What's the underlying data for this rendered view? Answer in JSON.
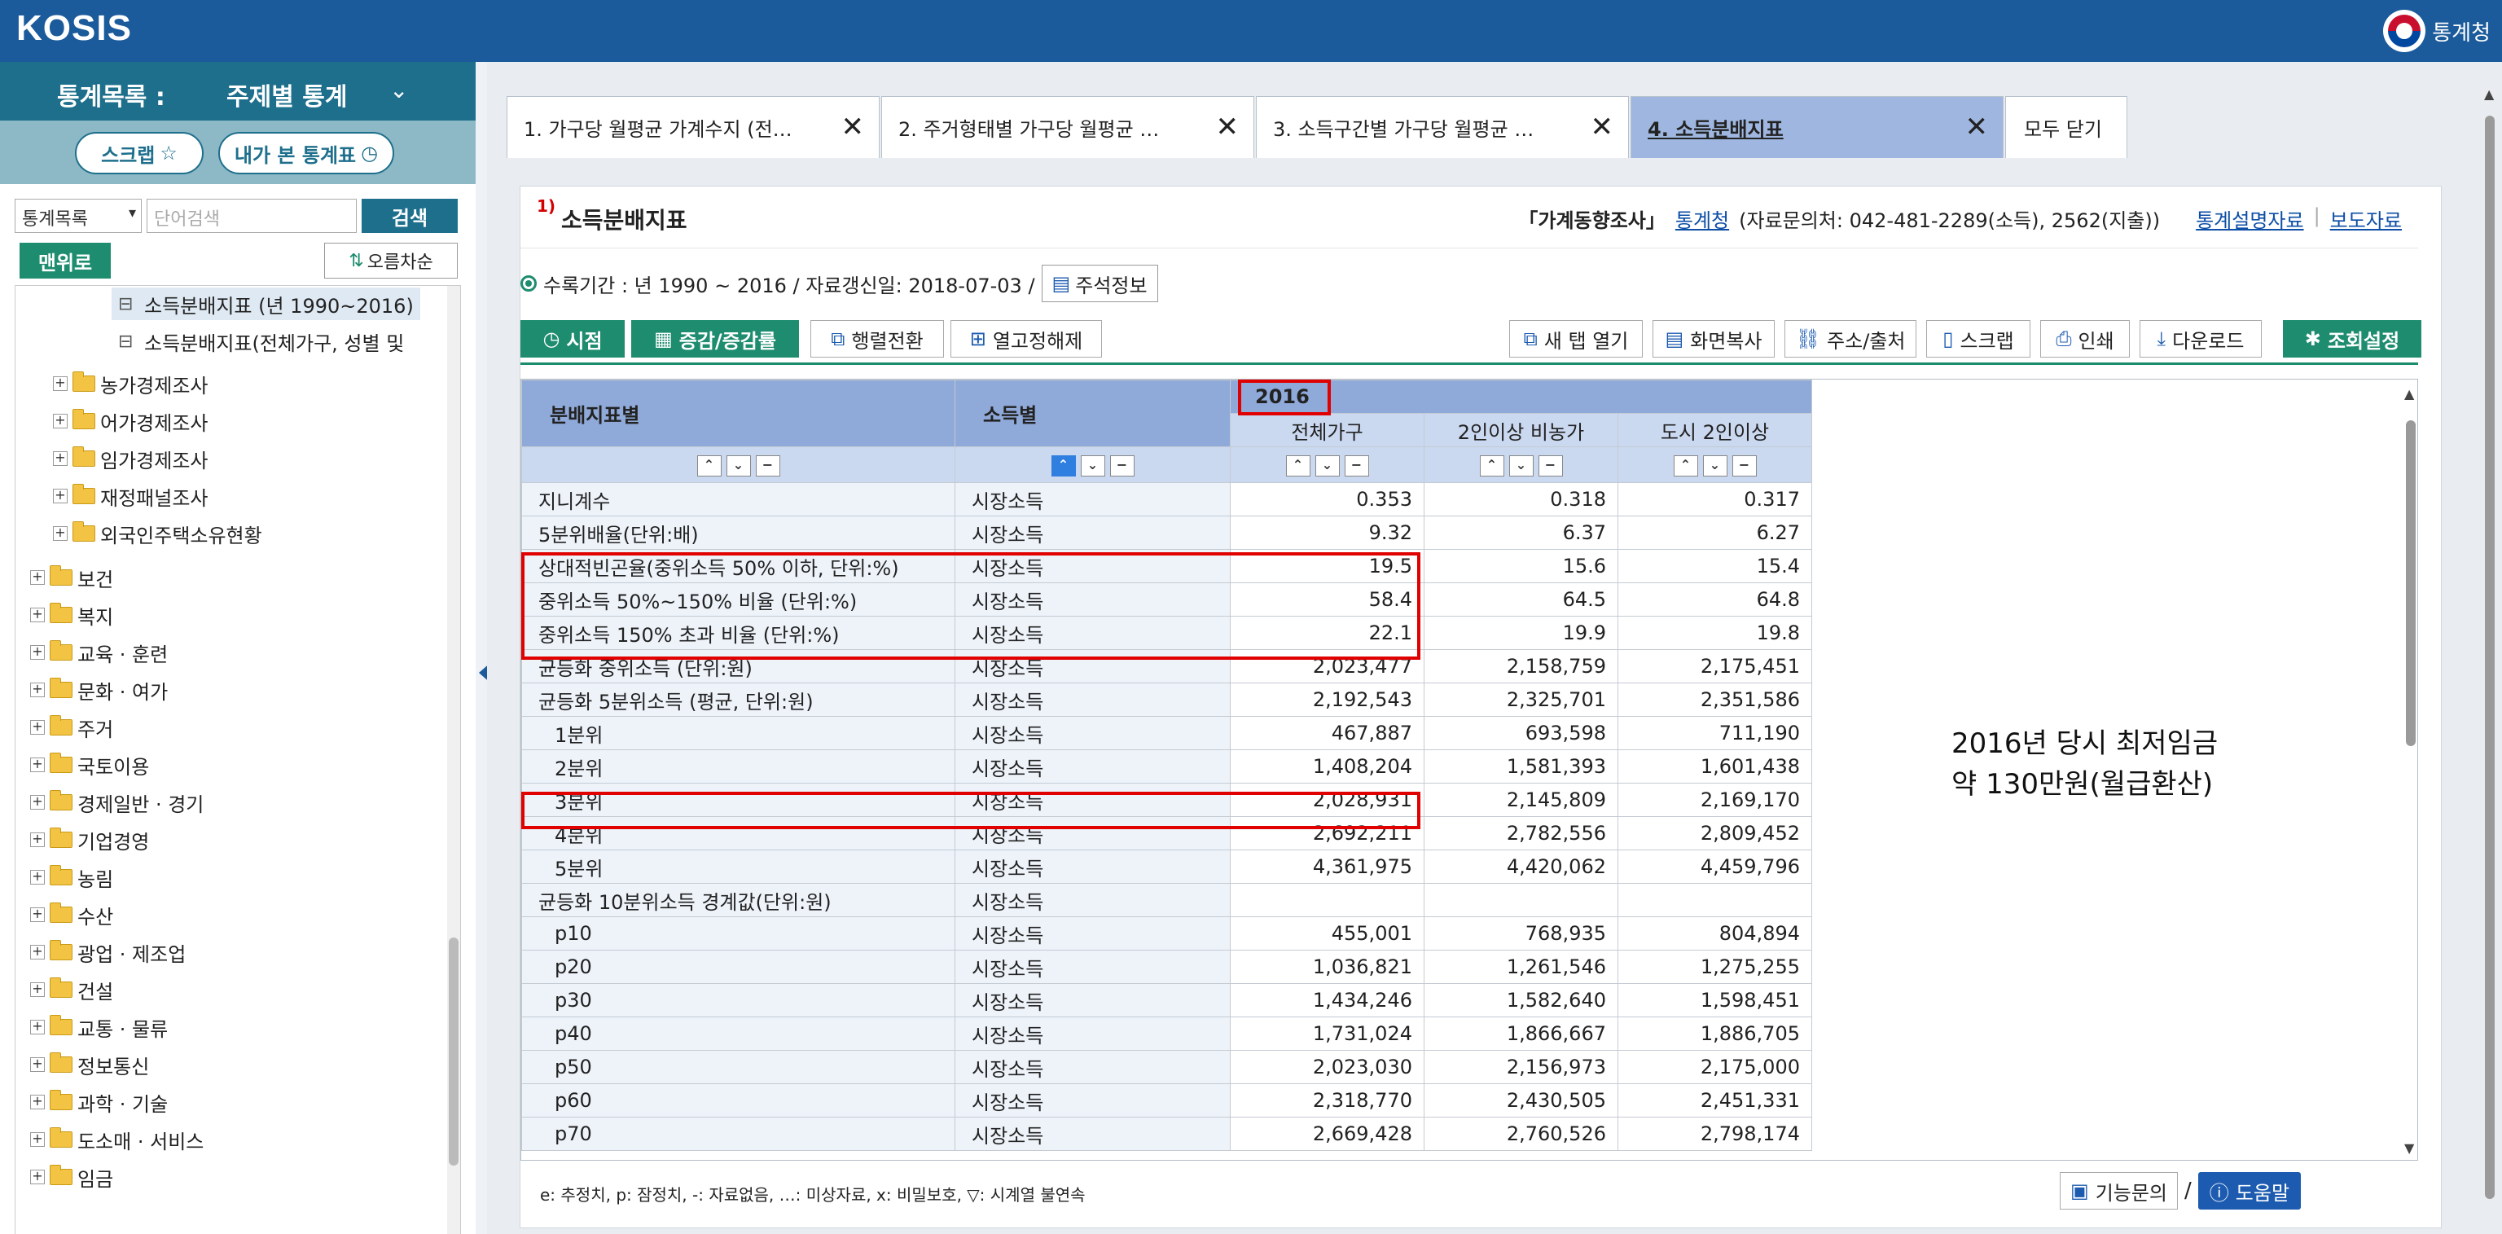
{
  "header": {
    "logo": "KOSIS",
    "brand": "통계청"
  },
  "sidebar": {
    "head_label": "통계목록 :",
    "head_select": "주제별 통계",
    "scrap_label": "스크랩",
    "history_label": "내가 본 통계표",
    "search_select": "통계목록",
    "search_placeholder": "단어검색",
    "search_button": "검색",
    "top_button": "맨위로",
    "sort_button": "오름차순",
    "tree": [
      {
        "label": "소득분배지표 (년 1990~2016)",
        "type": "doc",
        "level": 3,
        "selected": true
      },
      {
        "label": "소득분배지표(전체가구, 성별 및",
        "type": "doc",
        "level": 3
      },
      {
        "label": "농가경제조사",
        "type": "folder",
        "level": 1
      },
      {
        "label": "어가경제조사",
        "type": "folder",
        "level": 1
      },
      {
        "label": "임가경제조사",
        "type": "folder",
        "level": 1
      },
      {
        "label": "재정패널조사",
        "type": "folder",
        "level": 1
      },
      {
        "label": "외국인주택소유현황",
        "type": "folder",
        "level": 1
      },
      {
        "label": "보건",
        "type": "folder",
        "level": 0
      },
      {
        "label": "복지",
        "type": "folder",
        "level": 0
      },
      {
        "label": "교육 · 훈련",
        "type": "folder",
        "level": 0
      },
      {
        "label": "문화 · 여가",
        "type": "folder",
        "level": 0
      },
      {
        "label": "주거",
        "type": "folder",
        "level": 0
      },
      {
        "label": "국토이용",
        "type": "folder",
        "level": 0
      },
      {
        "label": "경제일반 · 경기",
        "type": "folder",
        "level": 0
      },
      {
        "label": "기업경영",
        "type": "folder",
        "level": 0
      },
      {
        "label": "농림",
        "type": "folder",
        "level": 0
      },
      {
        "label": "수산",
        "type": "folder",
        "level": 0
      },
      {
        "label": "광업 · 제조업",
        "type": "folder",
        "level": 0
      },
      {
        "label": "건설",
        "type": "folder",
        "level": 0
      },
      {
        "label": "교통 · 물류",
        "type": "folder",
        "level": 0
      },
      {
        "label": "정보통신",
        "type": "folder",
        "level": 0
      },
      {
        "label": "과학 · 기술",
        "type": "folder",
        "level": 0
      },
      {
        "label": "도소매 · 서비스",
        "type": "folder",
        "level": 0
      },
      {
        "label": "임금",
        "type": "folder",
        "level": 0
      }
    ]
  },
  "tabs": [
    {
      "label": "1. 가구당 월평균 가계수지 (전…"
    },
    {
      "label": "2. 주거형태별 가구당 월평균 …"
    },
    {
      "label": "3. 소득구간별 가구당 월평균 …"
    },
    {
      "label": "4. 소득분배지표",
      "active": true
    }
  ],
  "close_all": "모두 닫기",
  "title": {
    "sup": "1)",
    "text": "소득분배지표",
    "survey": "「가계동향조사」",
    "agency": "통계청",
    "contact": "(자료문의처: 042-481-2289(소득), 2562(지출))",
    "desc_link": "통계설명자료",
    "press_link": "보도자료"
  },
  "period": {
    "text": "수록기간 : 년 1990 ~ 2016 / 자료갱신일: 2018-07-03 /",
    "note_button": "주석정보"
  },
  "toolbar": {
    "time": "시점",
    "change": "증감/증감률",
    "pivot": "행렬전환",
    "unfreeze": "열고정해제",
    "newtab": "새 탭 열기",
    "copy": "화면복사",
    "url": "주소/출처",
    "scrap": "스크랩",
    "print": "인쇄",
    "download": "다운로드",
    "settings": "조회설정"
  },
  "table": {
    "col1": "분배지표별",
    "col2": "소득별",
    "year": "2016",
    "sub": [
      "전체가구",
      "2인이상 비농가",
      "도시 2인이상"
    ],
    "rows": [
      {
        "name": "지니계수",
        "income": "시장소득",
        "v": [
          "0.353",
          "0.318",
          "0.317"
        ]
      },
      {
        "name": "5분위배율(단위:배)",
        "income": "시장소득",
        "v": [
          "9.32",
          "6.37",
          "6.27"
        ]
      },
      {
        "name": "상대적빈곤율(중위소득 50% 이하, 단위:%)",
        "income": "시장소득",
        "v": [
          "19.5",
          "15.6",
          "15.4"
        ]
      },
      {
        "name": "중위소득 50%~150% 비율 (단위:%)",
        "income": "시장소득",
        "v": [
          "58.4",
          "64.5",
          "64.8"
        ]
      },
      {
        "name": "중위소득 150% 초과 비율 (단위:%)",
        "income": "시장소득",
        "v": [
          "22.1",
          "19.9",
          "19.8"
        ]
      },
      {
        "name": "균등화 중위소득 (단위:원)",
        "income": "시장소득",
        "v": [
          "2,023,477",
          "2,158,759",
          "2,175,451"
        ]
      },
      {
        "name": "균등화 5분위소득 (평균, 단위:원)",
        "income": "시장소득",
        "v": [
          "2,192,543",
          "2,325,701",
          "2,351,586"
        ]
      },
      {
        "name": "1분위",
        "income": "시장소득",
        "indent": 1,
        "v": [
          "467,887",
          "693,598",
          "711,190"
        ]
      },
      {
        "name": "2분위",
        "income": "시장소득",
        "indent": 1,
        "v": [
          "1,408,204",
          "1,581,393",
          "1,601,438"
        ]
      },
      {
        "name": "3분위",
        "income": "시장소득",
        "indent": 1,
        "v": [
          "2,028,931",
          "2,145,809",
          "2,169,170"
        ]
      },
      {
        "name": "4분위",
        "income": "시장소득",
        "indent": 1,
        "v": [
          "2,692,211",
          "2,782,556",
          "2,809,452"
        ]
      },
      {
        "name": "5분위",
        "income": "시장소득",
        "indent": 1,
        "v": [
          "4,361,975",
          "4,420,062",
          "4,459,796"
        ]
      },
      {
        "name": "균등화 10분위소득 경계값(단위:원)",
        "income": "시장소득",
        "v": [
          "",
          "",
          ""
        ]
      },
      {
        "name": "p10",
        "income": "시장소득",
        "indent": 1,
        "v": [
          "455,001",
          "768,935",
          "804,894"
        ]
      },
      {
        "name": "p20",
        "income": "시장소득",
        "indent": 1,
        "v": [
          "1,036,821",
          "1,261,546",
          "1,275,255"
        ]
      },
      {
        "name": "p30",
        "income": "시장소득",
        "indent": 1,
        "v": [
          "1,434,246",
          "1,582,640",
          "1,598,451"
        ]
      },
      {
        "name": "p40",
        "income": "시장소득",
        "indent": 1,
        "v": [
          "1,731,024",
          "1,866,667",
          "1,886,705"
        ]
      },
      {
        "name": "p50",
        "income": "시장소득",
        "indent": 1,
        "v": [
          "2,023,030",
          "2,156,973",
          "2,175,000"
        ]
      },
      {
        "name": "p60",
        "income": "시장소득",
        "indent": 1,
        "v": [
          "2,318,770",
          "2,430,505",
          "2,451,331"
        ]
      },
      {
        "name": "p70",
        "income": "시장소득",
        "indent": 1,
        "v": [
          "2,669,428",
          "2,760,526",
          "2,798,174"
        ]
      }
    ]
  },
  "annotation": {
    "line1": "2016년 당시 최저임금",
    "line2": "약 130만원(월급환산)"
  },
  "footer": {
    "note": "e: 추정치, p: 잠정치, -: 자료없음, …: 미상자료, x: 비밀보호, ▽: 시계열 불연속",
    "func_button": "기능문의",
    "separator": "/",
    "help_button": "도움말"
  },
  "colors": {
    "header_bg": "#1c5b9b",
    "sidebar_bg": "#1e6f8c",
    "accent_green": "#1e8c6f",
    "table_header": "#8fa9d9",
    "highlight": "#e00000"
  }
}
